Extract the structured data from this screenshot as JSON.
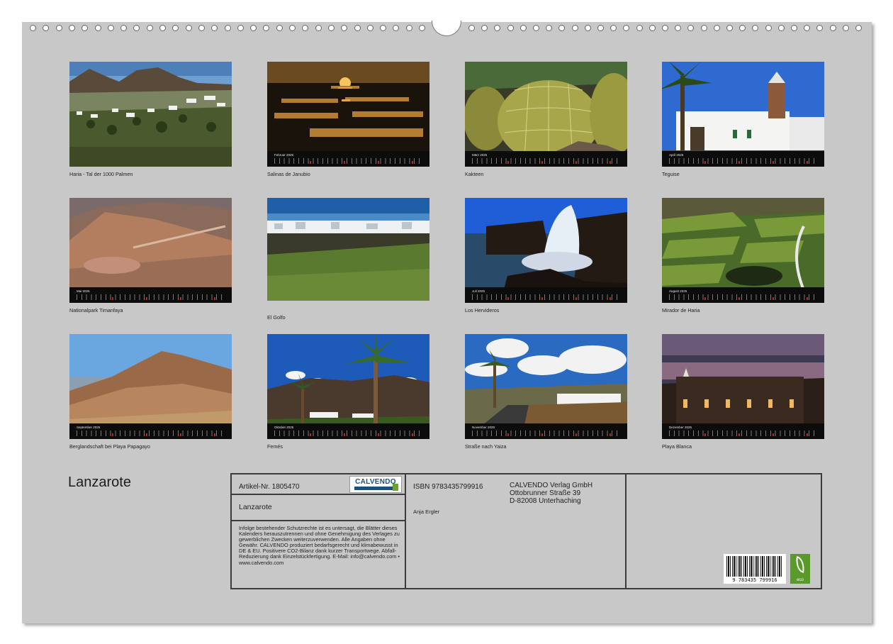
{
  "months": [
    {
      "caption": "Haria - Tal der 1000 Palmen",
      "month": "",
      "scene": "valley"
    },
    {
      "caption": "Salinas de Janubio",
      "month": "Februar 2025",
      "scene": "saltpans"
    },
    {
      "caption": "Kakteen",
      "month": "März 2025",
      "scene": "cactus"
    },
    {
      "caption": "Teguise",
      "month": "April 2025",
      "scene": "church"
    },
    {
      "caption": "Nationalpark Timanfaya",
      "month": "Mai 2025",
      "scene": "volcano"
    },
    {
      "caption": "El Golfo",
      "month": "",
      "scene": "coastvillage"
    },
    {
      "caption": "Los Hervideros",
      "month": "Juli 2025",
      "scene": "waves"
    },
    {
      "caption": "Mirador de Haria",
      "month": "August 2025",
      "scene": "terraces"
    },
    {
      "caption": "Berglandschaft bei Playa Papagayo",
      "month": "September 2025",
      "scene": "mountain"
    },
    {
      "caption": "Femés",
      "month": "Oktober 2025",
      "scene": "palmhill"
    },
    {
      "caption": "Straße nach Yaiza",
      "month": "November 2025",
      "scene": "road"
    },
    {
      "caption": "Playa Blanca",
      "month": "Dezember 2025",
      "scene": "dusk"
    }
  ],
  "title": "Lanzarote",
  "info": {
    "article": "Artikel-Nr. 1805470",
    "logo": "CALVENDO",
    "calendar_title": "Lanzarote",
    "legal": "Infolge bestehender Schutzrechte ist es untersagt, die Blätter dieses Kalenders herauszutrennen und ohne Genehmigung des Verlages zu gewerblichen Zwecken weiterzuverwenden. Alle Angaben ohne Gewähr. CALVENDO produziert bedarfsgerecht und klimabewusst in DE & EU. Positivere CO2-Bilanz dank kurzer Transportwege. Abfall-Reduzierung dank Einzelstückfertigung. E-Mail: info@calvendo.com • www.calvendo.com",
    "isbn": "ISBN 9783435799916",
    "author": "Anja Ergler",
    "publisher": [
      "CALVENDO Verlag GmbH",
      "Ottobrunner Straße 39",
      "D-82008 Unterhaching"
    ],
    "barcode_number": "9 783435 799916",
    "eco_label": "eco"
  },
  "colors": {
    "sheet": "#c8c8c8",
    "calendar_bar": "#0c0c0c",
    "border": "#3c3c3c"
  }
}
